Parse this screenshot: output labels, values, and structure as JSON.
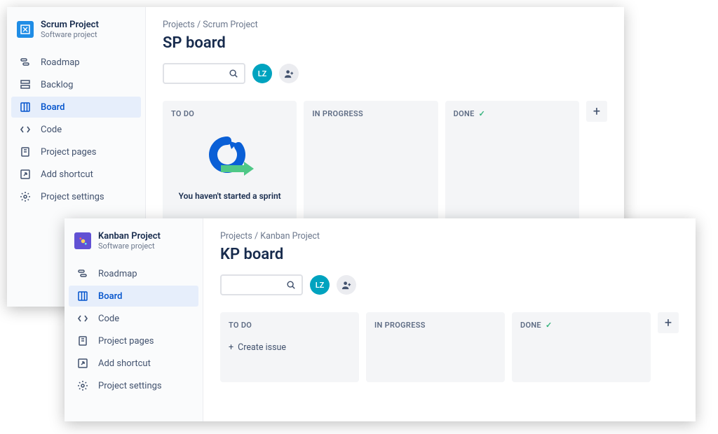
{
  "scrum": {
    "project_name": "Scrum Project",
    "project_type": "Software project",
    "nav": {
      "roadmap": "Roadmap",
      "backlog": "Backlog",
      "board": "Board",
      "code": "Code",
      "pages": "Project pages",
      "shortcut": "Add shortcut",
      "settings": "Project settings"
    },
    "crumb_root": "Projects",
    "crumb_sep": "/",
    "crumb_leaf": "Scrum Project",
    "title": "SP board",
    "avatar_initials": "LZ",
    "columns": {
      "todo": "TO DO",
      "inprogress": "IN PROGRESS",
      "done": "DONE"
    },
    "empty_message": "You haven't started a sprint"
  },
  "kanban": {
    "project_name": "Kanban Project",
    "project_type": "Software project",
    "nav": {
      "roadmap": "Roadmap",
      "board": "Board",
      "code": "Code",
      "pages": "Project pages",
      "shortcut": "Add shortcut",
      "settings": "Project settings"
    },
    "crumb_root": "Projects",
    "crumb_sep": "/",
    "crumb_leaf": "Kanban Project",
    "title": "KP board",
    "avatar_initials": "LZ",
    "columns": {
      "todo": "TO DO",
      "inprogress": "IN PROGRESS",
      "done": "DONE"
    },
    "create_issue": "Create issue"
  }
}
